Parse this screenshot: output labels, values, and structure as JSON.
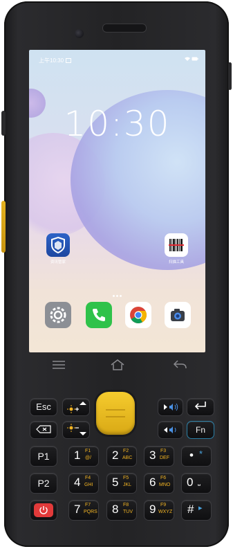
{
  "status_bar": {
    "time": "上午10:30",
    "time_icon": "calendar-icon",
    "icons": "wifi battery"
  },
  "lock_clock": "10:30",
  "apps": [
    {
      "name": "shield-app",
      "label": "资讯管家"
    },
    {
      "name": "barcode-app",
      "label": "扫描工具"
    }
  ],
  "dock": [
    {
      "name": "settings-icon",
      "label": ""
    },
    {
      "name": "phone-icon",
      "label": ""
    },
    {
      "name": "chrome-icon",
      "label": ""
    },
    {
      "name": "camera-icon",
      "label": ""
    }
  ],
  "nav": {
    "menu": "≡",
    "home": "⌂",
    "back": "↶"
  },
  "keys": {
    "esc": "Esc",
    "fn": "Fn",
    "p1": "P1",
    "p2": "P2",
    "enter": "↵",
    "backspace": "⌫",
    "k1": {
      "num": "1",
      "f": "F1",
      "sub": "@/"
    },
    "k2": {
      "num": "2",
      "f": "F2",
      "sub": "ABC"
    },
    "k3": {
      "num": "3",
      "f": "F3",
      "sub": "DEF"
    },
    "k4": {
      "num": "4",
      "f": "F4",
      "sub": "GHI"
    },
    "k5": {
      "num": "5",
      "f": "F5",
      "sub": "JKL"
    },
    "k6": {
      "num": "6",
      "f": "F6",
      "sub": "MNO"
    },
    "k7": {
      "num": "7",
      "f": "F7",
      "sub": "PQRS"
    },
    "k8": {
      "num": "8",
      "f": "F8",
      "sub": "TUV"
    },
    "k9": {
      "num": "9",
      "f": "F9",
      "sub": "WXYZ"
    },
    "k0": {
      "num": "0",
      "sub": "⎵"
    },
    "dot": {
      "num": "•",
      "sub": "*"
    },
    "hash": {
      "num": "#",
      "sub": "▸"
    }
  },
  "colors": {
    "accent": "#f2b423",
    "scan": "#e9bb22",
    "power": "#e23a3a"
  }
}
